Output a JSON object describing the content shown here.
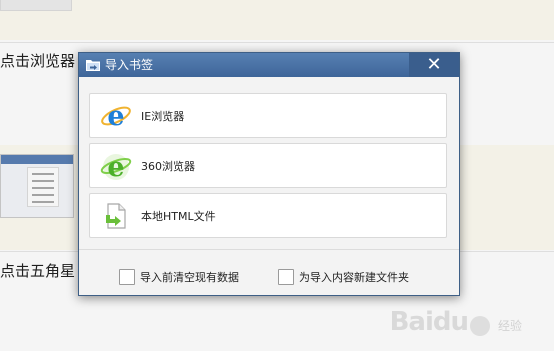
{
  "background": {
    "step1_text": "点击浏览器",
    "step2_text": "点击五角星",
    "watermark_logo": "Baidu",
    "watermark_sub": "经验"
  },
  "dialog": {
    "title": "导入书签",
    "close_label": "✕",
    "options": [
      {
        "label": "IE浏览器",
        "icon": "ie-icon"
      },
      {
        "label": "360浏览器",
        "icon": "360-browser-icon"
      },
      {
        "label": "本地HTML文件",
        "icon": "html-file-icon"
      }
    ],
    "checkboxes": [
      {
        "label": "导入前清空现有数据",
        "checked": false
      },
      {
        "label": "为导入内容新建文件夹",
        "checked": false
      }
    ]
  },
  "colors": {
    "titlebar": "#4a72a6",
    "ie_blue": "#1e7fd8",
    "browser360_green": "#4caf2a",
    "file_arrow_green": "#6abf3a"
  }
}
